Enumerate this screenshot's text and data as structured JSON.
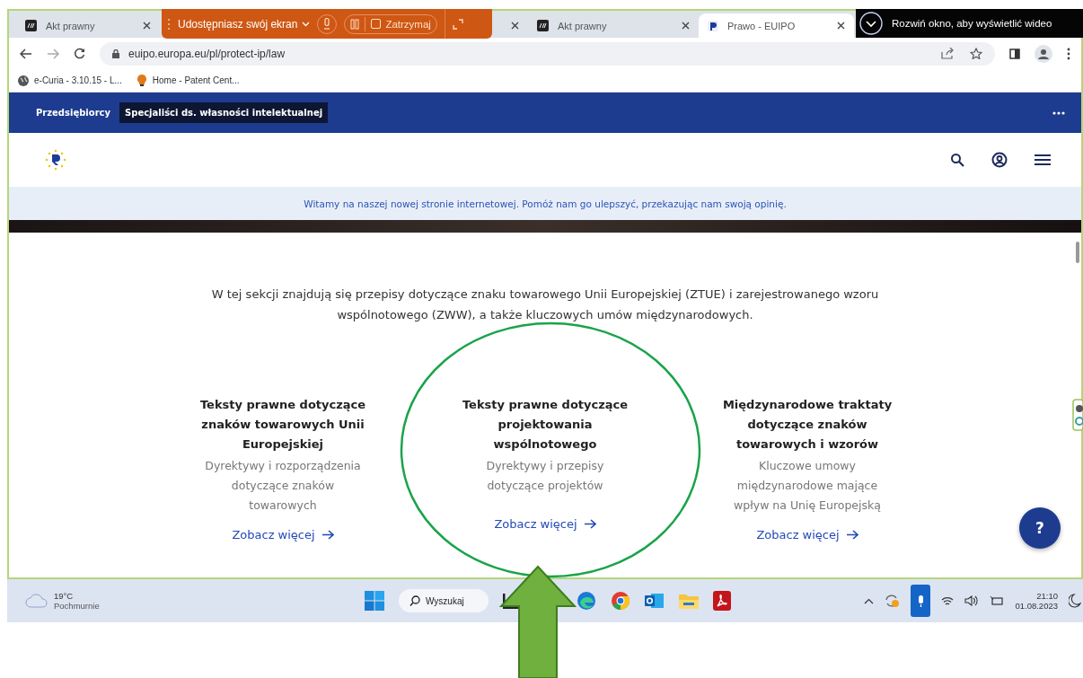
{
  "tabs": [
    {
      "title": "Akt prawny",
      "selected": false
    },
    {
      "selected": false
    },
    {
      "title": "Akt prawny",
      "selected": false
    },
    {
      "title": "Prawo - EUIPO",
      "selected": true
    }
  ],
  "share_bar": {
    "label": "Udostępniasz swój ekran",
    "stop": "Zatrzymaj"
  },
  "video_notice": "Rozwiń okno, aby wyświetlić wideo",
  "address": "euipo.europa.eu/pl/protect-ip/law",
  "bookmarks": [
    "e-Curia - 3.10.15 - L...",
    "Home - Patent Cent..."
  ],
  "site_nav": [
    {
      "label": "Przedsiębiorcy",
      "selected": false
    },
    {
      "label": "Specjaliści ds. własności intelektualnej",
      "selected": true
    }
  ],
  "banner": "Witamy na naszej nowej stronie internetowej. Pomóż nam go ulepszyć, przekazując nam swoją opinię.",
  "intro": "W tej sekcji znajdują się przepisy dotyczące znaku towarowego Unii Europejskiej (ZTUE) i zarejestrowanego wzoru wspólnotowego (ZWW), a także kluczowych umów międzynarodowych.",
  "cards": [
    {
      "title": "Teksty prawne dotyczące znaków towarowych Unii Europejskiej",
      "text": "Dyrektywy i rozporządzenia dotyczące znaków towarowych",
      "link": "Zobacz więcej"
    },
    {
      "title": "Teksty prawne dotyczące projektowania wspólnotowego",
      "text": "Dyrektywy i przepisy dotyczące projektów",
      "link": "Zobacz więcej"
    },
    {
      "title": "Międzynarodowe traktaty dotyczące znaków towarowych i wzorów",
      "text": "Kluczowe umowy międzynarodowe mające wpływ na Unię Europejską",
      "link": "Zobacz więcej"
    }
  ],
  "help_button": "?",
  "taskbar": {
    "temperature": "19°C",
    "weather": "Pochmurnie",
    "search": "Wyszukaj",
    "time": "21:10",
    "date": "01.08.2023"
  }
}
